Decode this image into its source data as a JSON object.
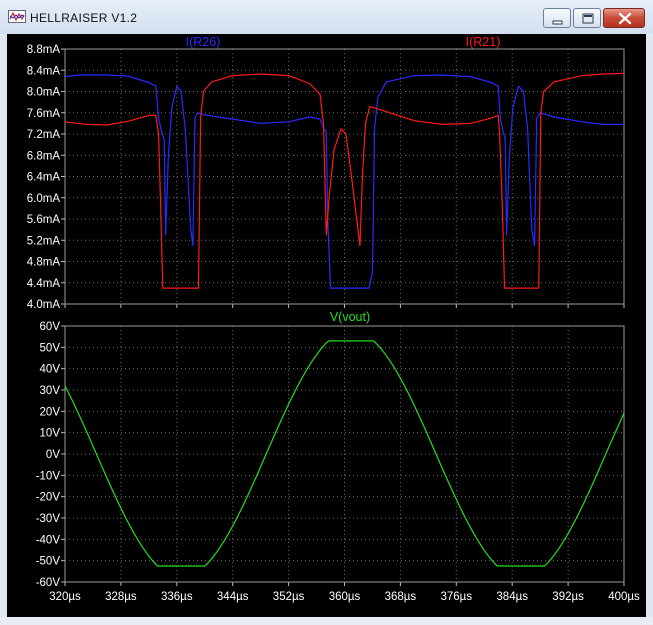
{
  "window": {
    "title": "HELLRAISER V1.2",
    "controls": [
      "minimize",
      "maximize",
      "close"
    ]
  },
  "colors": {
    "background": "#000000",
    "grid": "#6e6e6e",
    "axis_text": "#ffffff",
    "IR26": "#2a2aff",
    "IR21": "#ff1a1a",
    "vout": "#22dd22"
  },
  "chart_data": [
    {
      "type": "line",
      "grid": true,
      "legend": "top",
      "xlim": [
        320,
        400
      ],
      "ylim": [
        4.0,
        8.8
      ],
      "yticks": [
        "4.0mA",
        "4.4mA",
        "4.8mA",
        "5.2mA",
        "5.6mA",
        "6.0mA",
        "6.4mA",
        "6.8mA",
        "7.2mA",
        "7.6mA",
        "8.0mA",
        "8.4mA",
        "8.8mA"
      ],
      "series": [
        {
          "name": "I(R26)",
          "points": [
            [
              320,
              8.28
            ],
            [
              322,
              8.31
            ],
            [
              326,
              8.31
            ],
            [
              329,
              8.29
            ],
            [
              332,
              8.17
            ],
            [
              333,
              8.1
            ],
            [
              333.4,
              7.5
            ],
            [
              333.8,
              7.25
            ],
            [
              334.2,
              7.1
            ],
            [
              334.4,
              5.3
            ],
            [
              334.8,
              6.8
            ],
            [
              335.3,
              7.7
            ],
            [
              336.0,
              8.1
            ],
            [
              336.6,
              8.0
            ],
            [
              337.2,
              7.3
            ],
            [
              338.0,
              5.4
            ],
            [
              338.3,
              5.1
            ],
            [
              338.6,
              7.5
            ],
            [
              339,
              7.6
            ],
            [
              340,
              7.56
            ],
            [
              344,
              7.48
            ],
            [
              348,
              7.4
            ],
            [
              352,
              7.43
            ],
            [
              355,
              7.52
            ],
            [
              356.5,
              7.48
            ],
            [
              357,
              7.3
            ],
            [
              357.4,
              7.25
            ],
            [
              357.6,
              5.6
            ],
            [
              358,
              4.3
            ],
            [
              360,
              4.3
            ],
            [
              362,
              4.3
            ],
            [
              363.5,
              4.3
            ],
            [
              364,
              4.6
            ],
            [
              364.3,
              7.3
            ],
            [
              364.8,
              7.9
            ],
            [
              366,
              8.18
            ],
            [
              370,
              8.3
            ],
            [
              374,
              8.31
            ],
            [
              378,
              8.28
            ],
            [
              381,
              8.17
            ],
            [
              382,
              8.1
            ],
            [
              382.3,
              7.5
            ],
            [
              382.7,
              7.25
            ],
            [
              383,
              7.1
            ],
            [
              383.2,
              5.3
            ],
            [
              383.6,
              6.8
            ],
            [
              384.1,
              7.7
            ],
            [
              384.9,
              8.1
            ],
            [
              385.6,
              8.0
            ],
            [
              386.2,
              7.3
            ],
            [
              386.8,
              5.4
            ],
            [
              387.2,
              5.1
            ],
            [
              387.5,
              7.5
            ],
            [
              388,
              7.6
            ],
            [
              390,
              7.52
            ],
            [
              394,
              7.43
            ],
            [
              397,
              7.38
            ],
            [
              400,
              7.38
            ]
          ]
        },
        {
          "name": "I(R21)",
          "points": [
            [
              320,
              7.43
            ],
            [
              323,
              7.38
            ],
            [
              326,
              7.37
            ],
            [
              329,
              7.44
            ],
            [
              332,
              7.55
            ],
            [
              333,
              7.55
            ],
            [
              333.4,
              7.2
            ],
            [
              333.7,
              5.8
            ],
            [
              334,
              4.3
            ],
            [
              336,
              4.3
            ],
            [
              338,
              4.3
            ],
            [
              339.1,
              4.3
            ],
            [
              339.4,
              7.5
            ],
            [
              339.8,
              8.0
            ],
            [
              341,
              8.18
            ],
            [
              344,
              8.3
            ],
            [
              348,
              8.33
            ],
            [
              352,
              8.3
            ],
            [
              355,
              8.15
            ],
            [
              356.5,
              7.95
            ],
            [
              357,
              7.4
            ],
            [
              357.4,
              5.3
            ],
            [
              357.8,
              6.0
            ],
            [
              358.5,
              6.9
            ],
            [
              359.5,
              7.3
            ],
            [
              360.2,
              7.2
            ],
            [
              361,
              6.4
            ],
            [
              362.2,
              5.1
            ],
            [
              362.6,
              6.5
            ],
            [
              363,
              7.4
            ],
            [
              363.6,
              7.72
            ],
            [
              366,
              7.62
            ],
            [
              370,
              7.45
            ],
            [
              374,
              7.38
            ],
            [
              378,
              7.4
            ],
            [
              381,
              7.5
            ],
            [
              382,
              7.55
            ],
            [
              382.2,
              7.2
            ],
            [
              382.6,
              5.8
            ],
            [
              382.9,
              4.3
            ],
            [
              385,
              4.3
            ],
            [
              387,
              4.3
            ],
            [
              387.8,
              4.3
            ],
            [
              388.1,
              7.6
            ],
            [
              388.5,
              8.0
            ],
            [
              390,
              8.18
            ],
            [
              394,
              8.3
            ],
            [
              397,
              8.33
            ],
            [
              400,
              8.34
            ]
          ]
        }
      ]
    },
    {
      "type": "line",
      "grid": true,
      "legend": "top",
      "xlim": [
        320,
        400
      ],
      "ylim": [
        -60,
        60
      ],
      "yticks": [
        "-60V",
        "-50V",
        "-40V",
        "-30V",
        "-20V",
        "-10V",
        "0V",
        "10V",
        "20V",
        "30V",
        "40V",
        "50V",
        "60V"
      ],
      "xticks": [
        "320µs",
        "328µs",
        "336µs",
        "344µs",
        "352µs",
        "360µs",
        "368µs",
        "376µs",
        "384µs",
        "392µs",
        "400µs"
      ],
      "series": [
        {
          "name": "V(vout)",
          "period_us": 48.6,
          "zero_cross_us": 348.8,
          "amplitude_V": 58,
          "clip_low_V": -52.5,
          "clip_high_V": 53
        }
      ]
    }
  ]
}
